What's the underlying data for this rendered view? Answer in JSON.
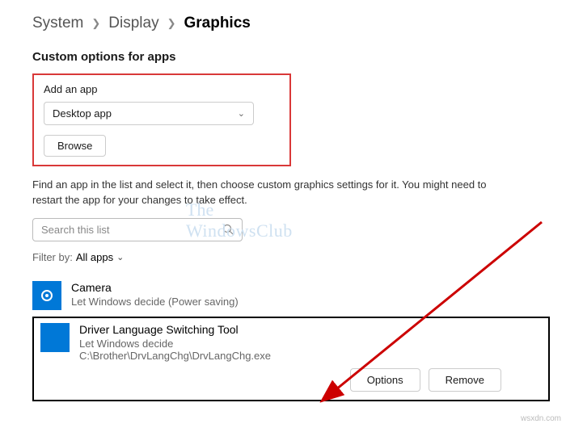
{
  "breadcrumb": {
    "seg1": "System",
    "seg2": "Display",
    "seg3": "Graphics"
  },
  "section_title": "Custom options for apps",
  "add_app": {
    "label": "Add an app",
    "dropdown_value": "Desktop app",
    "browse": "Browse"
  },
  "help": "Find an app in the list and select it, then choose custom graphics settings for it. You might need to restart the app for your changes to take effect.",
  "search": {
    "placeholder": "Search this list"
  },
  "filter": {
    "label": "Filter by:",
    "value": "All apps"
  },
  "apps": {
    "camera": {
      "name": "Camera",
      "sub": "Let Windows decide (Power saving)"
    },
    "driver": {
      "name": "Driver Language Switching Tool",
      "sub": "Let Windows decide",
      "path": "C:\\Brother\\DrvLangChg\\DrvLangChg.exe"
    }
  },
  "buttons": {
    "options": "Options",
    "remove": "Remove"
  },
  "watermark": {
    "line1": "The",
    "line2": "WindowsClub"
  },
  "credit": "wsxdn.com"
}
